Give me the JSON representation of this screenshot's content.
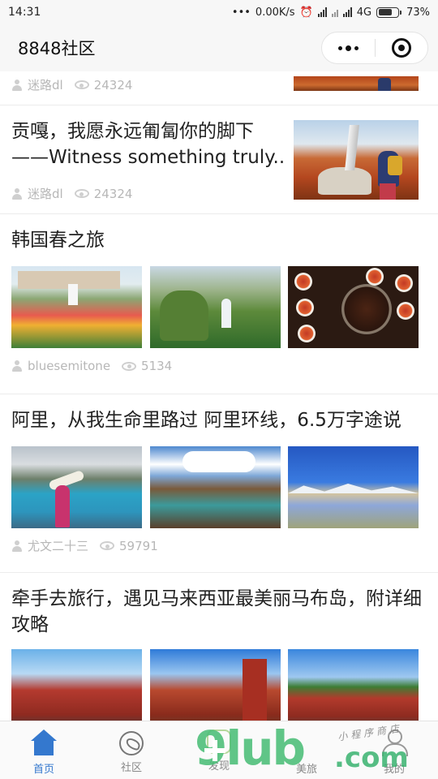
{
  "status_bar": {
    "time": "14:31",
    "dots": "•••",
    "network_speed": "0.00K/s",
    "network_type": "4G",
    "battery": "73%",
    "battery_level": 0.73
  },
  "nav": {
    "title": "8848社区"
  },
  "articles": [
    {
      "author": "迷路dl",
      "views": "24324"
    },
    {
      "title": "贡嘎，我愿永远匍匐你的脚下——Witness something truly..",
      "author": "迷路dl",
      "views": "24324"
    },
    {
      "title": "韩国春之旅",
      "author": "bluesemitone",
      "views": "5134"
    },
    {
      "title": "阿里，从我生命里路过 阿里环线，6.5万字途说",
      "author": "尤文二十三",
      "views": "59791"
    },
    {
      "title": "牵手去旅行，遇见马来西亚最美丽马布岛，附详细攻略"
    }
  ],
  "tabbar": {
    "tabs": [
      {
        "label": "首页",
        "icon": "home-icon",
        "active": true
      },
      {
        "label": "社区",
        "icon": "community-icon",
        "active": false
      },
      {
        "label": "发现",
        "icon": "discover-icon",
        "active": false
      },
      {
        "label": "美旅",
        "icon": "travel-icon",
        "active": false
      },
      {
        "label": "我的",
        "icon": "profile-icon",
        "active": false
      }
    ]
  },
  "watermark": {
    "brand": "9lub",
    "domain": ".com",
    "tagline": "小程序商店"
  },
  "colors": {
    "accent": "#3478ce",
    "meta_text": "#b7b7b7"
  }
}
